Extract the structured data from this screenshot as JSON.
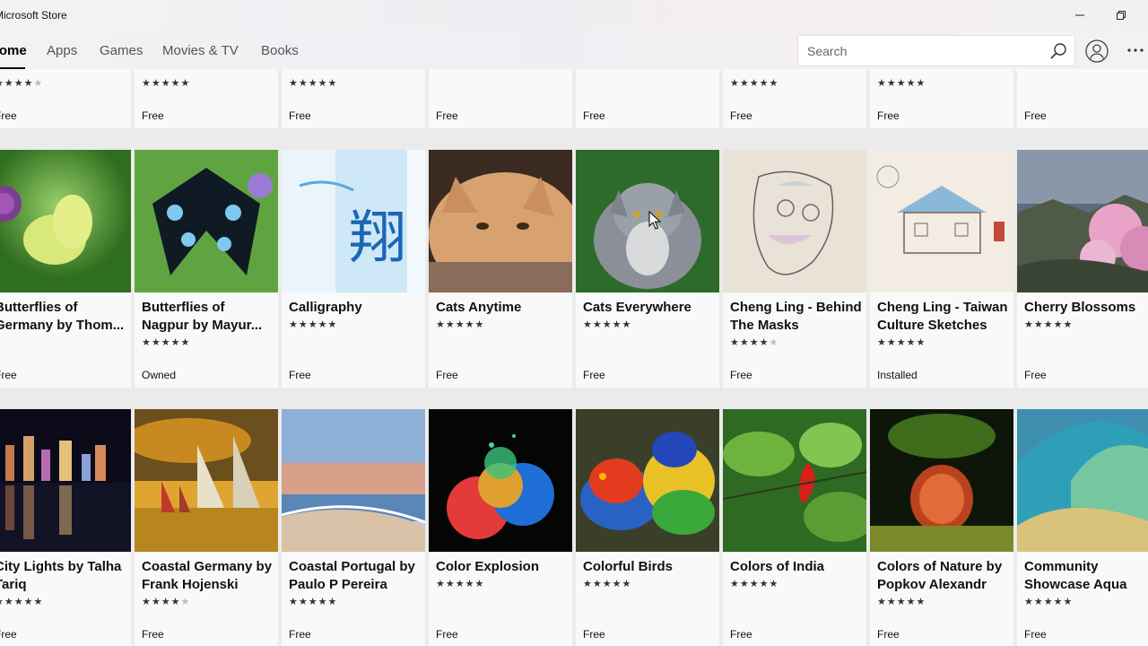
{
  "window": {
    "title": "Microsoft Store"
  },
  "nav": {
    "tabs": [
      {
        "label": "Home",
        "active": true
      },
      {
        "label": "Apps"
      },
      {
        "label": "Games"
      },
      {
        "label": "Movies & TV"
      },
      {
        "label": "Books"
      }
    ],
    "search_placeholder": "Search"
  },
  "rows": [
    {
      "tiles": [
        {
          "title1": "",
          "title2": "",
          "rating": 4,
          "price": "Free"
        },
        {
          "title1": "",
          "title2": "",
          "rating": 5,
          "price": "Free"
        },
        {
          "title1": "",
          "title2": "",
          "rating": 5,
          "price": "Free"
        },
        {
          "title1": "",
          "title2": "",
          "rating": 0,
          "price": "Free"
        },
        {
          "title1": "",
          "title2": "",
          "rating": 0,
          "price": "Free"
        },
        {
          "title1": "",
          "title2": "",
          "rating": 5,
          "price": "Free"
        },
        {
          "title1": "",
          "title2": "",
          "rating": 5,
          "price": "Free"
        },
        {
          "title1": "",
          "title2": "",
          "rating": 0,
          "price": "Free"
        }
      ]
    },
    {
      "tiles": [
        {
          "title1": "Butterflies of",
          "title2": "Germany by Thom...",
          "rating": 0,
          "price": "Free",
          "art": "butterfly-green"
        },
        {
          "title1": "Butterflies of",
          "title2": "Nagpur by Mayur...",
          "rating": 5,
          "price": "Owned",
          "art": "butterfly-blue"
        },
        {
          "title1": "Calligraphy",
          "title2": "",
          "rating": 5,
          "price": "Free",
          "art": "calligraphy"
        },
        {
          "title1": "Cats Anytime",
          "title2": "",
          "rating": 5,
          "price": "Free",
          "art": "cat-orange"
        },
        {
          "title1": "Cats Everywhere",
          "title2": "",
          "rating": 5,
          "price": "Free",
          "art": "cat-grey"
        },
        {
          "title1": "Cheng Ling - Behind",
          "title2": "The Masks",
          "rating": 4,
          "price": "Free",
          "art": "sketch-mask"
        },
        {
          "title1": "Cheng Ling - Taiwan",
          "title2": "Culture Sketches",
          "rating": 4.5,
          "price": "Installed",
          "art": "sketch-house"
        },
        {
          "title1": "Cherry Blossoms",
          "title2": "",
          "rating": 5,
          "price": "Free",
          "art": "cherry"
        }
      ]
    },
    {
      "tiles": [
        {
          "title1": "City Lights by Talha",
          "title2": "Tariq",
          "rating": 5,
          "price": "Free",
          "art": "city"
        },
        {
          "title1": "Coastal Germany by",
          "title2": "Frank Hojenski",
          "rating": 4,
          "price": "Free",
          "art": "sailboats"
        },
        {
          "title1": "Coastal Portugal by",
          "title2": "Paulo P Pereira",
          "rating": 5,
          "price": "Free",
          "art": "beach"
        },
        {
          "title1": "Color Explosion",
          "title2": "",
          "rating": 4.5,
          "price": "Free",
          "art": "explosion"
        },
        {
          "title1": "Colorful Birds",
          "title2": "",
          "rating": 5,
          "price": "Free",
          "art": "birds"
        },
        {
          "title1": "Colors of India",
          "title2": "",
          "rating": 5,
          "price": "Free",
          "art": "chili"
        },
        {
          "title1": "Colors of Nature by",
          "title2": "Popkov Alexandr",
          "rating": 5,
          "price": "Free",
          "art": "nature"
        },
        {
          "title1": "Community",
          "title2": "Showcase Aqua",
          "rating": 5,
          "price": "Free",
          "art": "wave"
        }
      ]
    }
  ],
  "colors": {
    "accent": "#000000",
    "tile_bg": "#f9f9f9",
    "page_bg": "#ebebeb"
  }
}
